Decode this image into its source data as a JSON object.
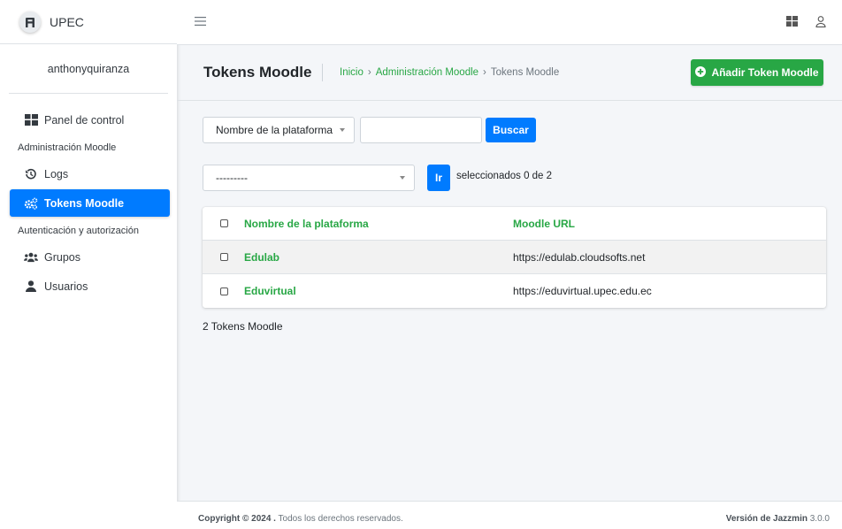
{
  "brand": {
    "name": "UPEC"
  },
  "user": {
    "name": "anthonyquiranza"
  },
  "sidebar": {
    "items": [
      {
        "type": "link",
        "label": "Panel de control",
        "icon": "dashboard-icon"
      },
      {
        "type": "header",
        "label": "Administración Moodle"
      },
      {
        "type": "link",
        "label": "Logs",
        "icon": "history-icon"
      },
      {
        "type": "link",
        "label": "Tokens Moodle",
        "icon": "cogs-icon",
        "active": true
      },
      {
        "type": "header",
        "label": "Autenticación y autorización"
      },
      {
        "type": "link",
        "label": "Grupos",
        "icon": "users-icon"
      },
      {
        "type": "link",
        "label": "Usuarios",
        "icon": "user-icon"
      }
    ]
  },
  "header": {
    "title": "Tokens Moodle",
    "breadcrumb": [
      "Inicio",
      "Administración Moodle",
      "Tokens Moodle"
    ],
    "breadcrumb_sep": "›",
    "add_button": "Añadir Token Moodle"
  },
  "filters": {
    "field_select": "Nombre de la plataforma",
    "search_value": "",
    "search_button": "Buscar"
  },
  "actions": {
    "action_select": "---------",
    "go_button": "Ir",
    "selected_text": "seleccionados 0 de 2"
  },
  "table": {
    "columns": [
      "Nombre de la plataforma",
      "Moodle URL"
    ],
    "rows": [
      {
        "name": "Edulab",
        "url": "https://edulab.cloudsofts.net"
      },
      {
        "name": "Eduvirtual",
        "url": "https://eduvirtual.upec.edu.ec"
      }
    ]
  },
  "result_count": "2 Tokens Moodle",
  "footer": {
    "copyright_bold": "Copyright © 2024 .",
    "copyright_rest": " Todos los derechos reservados.",
    "version_bold": "Versión de Jazzmin",
    "version_num": " 3.0.0"
  },
  "colors": {
    "primary": "#007bff",
    "success": "#28a745",
    "background": "#f4f6f9"
  }
}
